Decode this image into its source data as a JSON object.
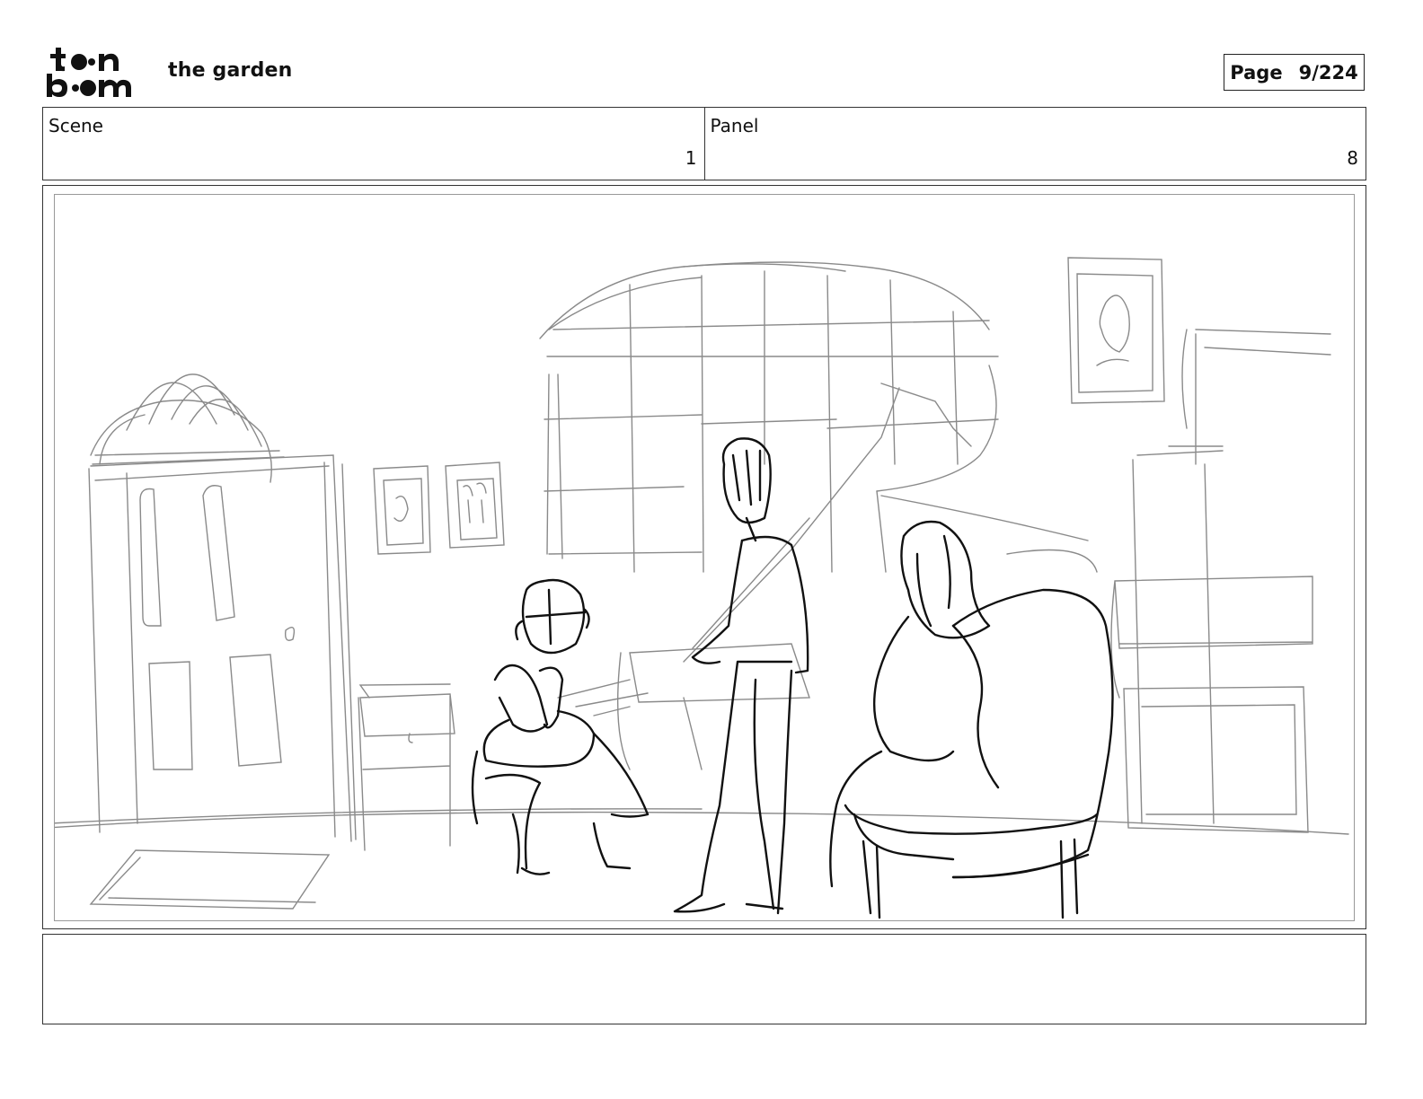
{
  "header": {
    "logo_name": "toon boom",
    "project_title": "the garden",
    "page_label": "Page",
    "page_value": "9/224"
  },
  "info": {
    "scene_label": "Scene",
    "scene_value": "1",
    "panel_label": "Panel",
    "panel_value": "8"
  },
  "panel": {
    "image": "pencil storyboard sketch",
    "stroke_colors": {
      "background": "#8a8a8a",
      "characters": "#111111"
    }
  },
  "notes": {
    "text": ""
  }
}
